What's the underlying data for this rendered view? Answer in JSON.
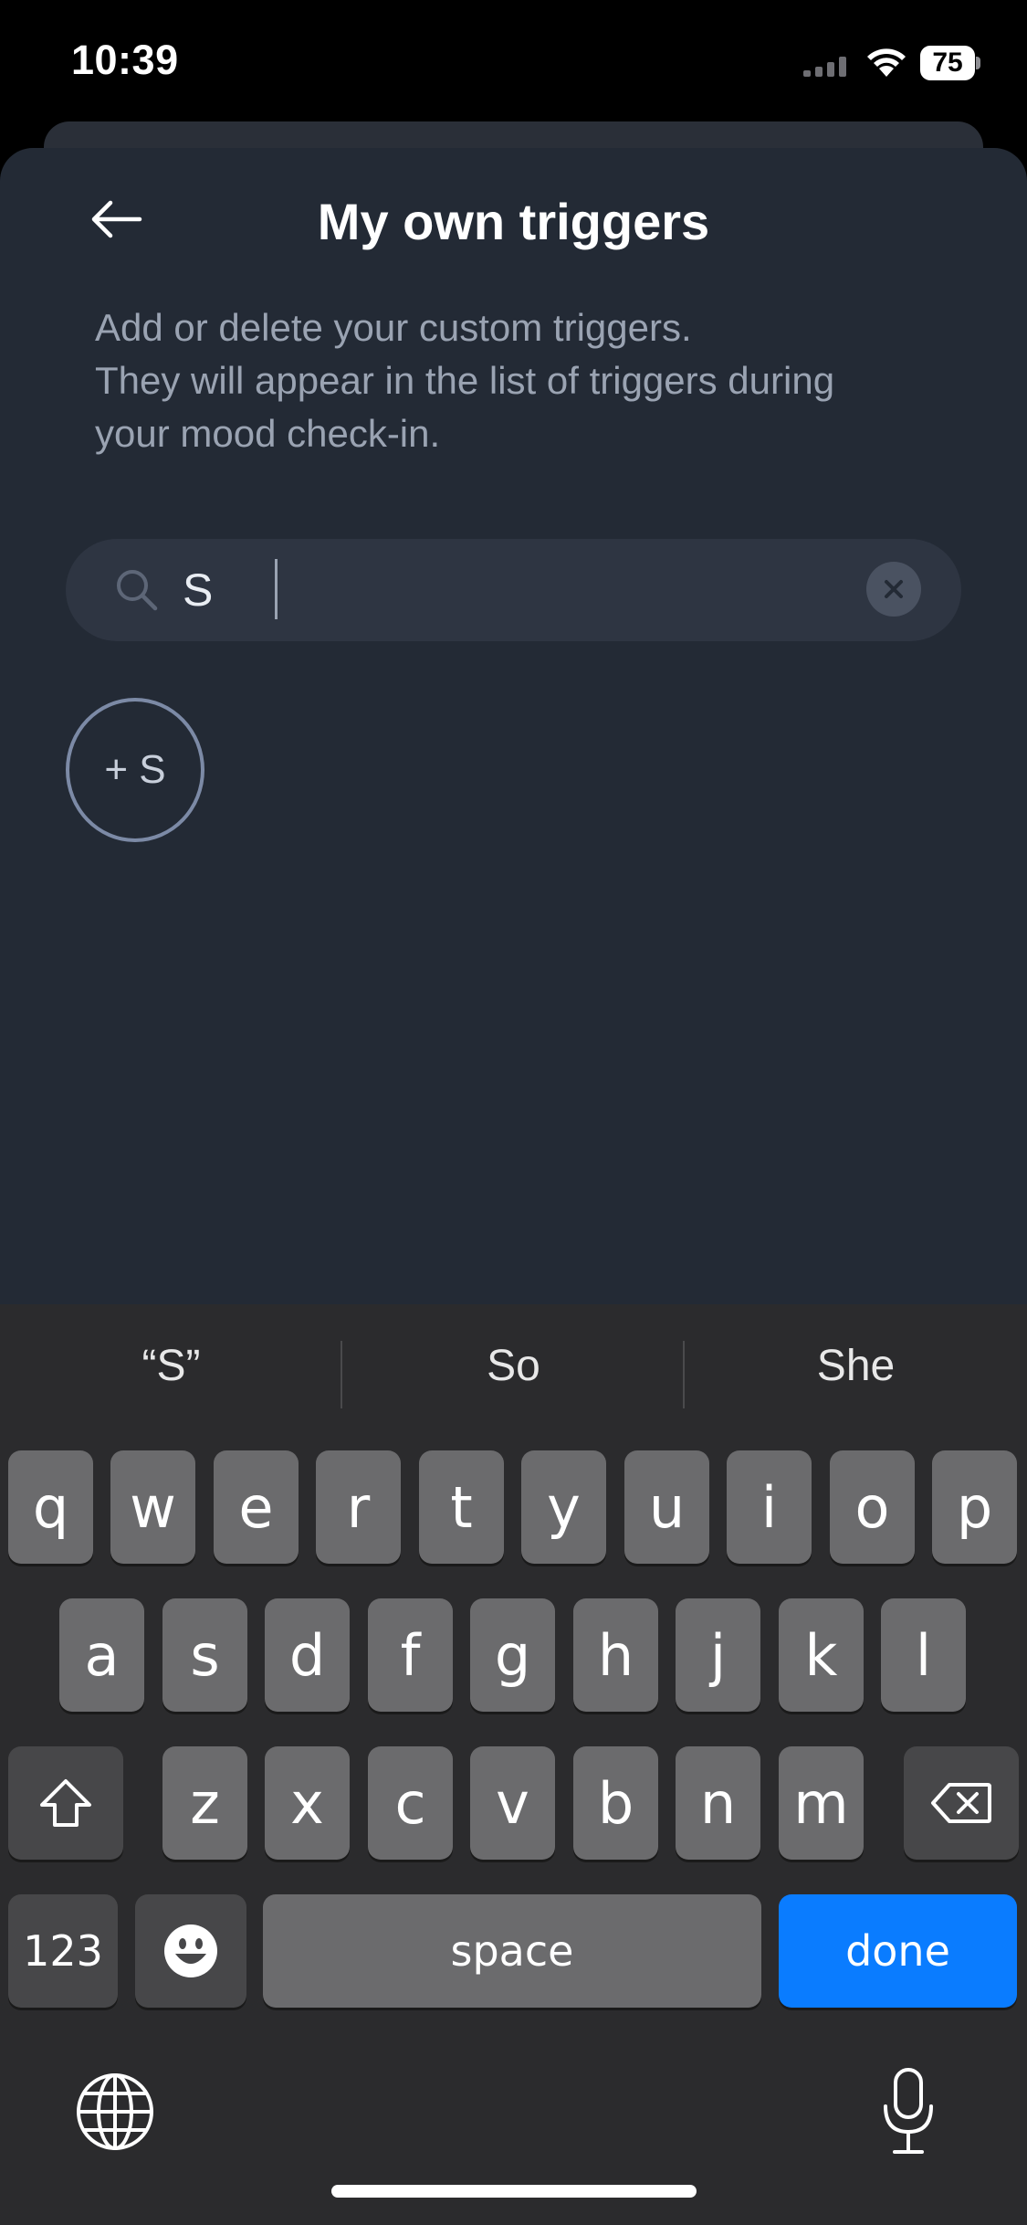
{
  "status_bar": {
    "time": "10:39",
    "battery": "75",
    "icons": [
      "signal-icon",
      "wifi-icon",
      "battery-icon"
    ]
  },
  "header": {
    "back_icon": "arrow-left-icon",
    "title": "My own triggers"
  },
  "description": {
    "lines": [
      "Add or delete your custom triggers.",
      "They will appear in the list of triggers during",
      "your mood check-in."
    ]
  },
  "search": {
    "value": "S",
    "icon": "search-icon",
    "clear_icon": "close-icon"
  },
  "add_chip": {
    "label": "+ S"
  },
  "keyboard": {
    "suggestions": [
      "“S”",
      "So",
      "She"
    ],
    "row1": [
      "q",
      "w",
      "e",
      "r",
      "t",
      "y",
      "u",
      "i",
      "o",
      "p"
    ],
    "row2": [
      "a",
      "s",
      "d",
      "f",
      "g",
      "h",
      "j",
      "k",
      "l"
    ],
    "row3": [
      "z",
      "x",
      "c",
      "v",
      "b",
      "n",
      "m"
    ],
    "numbers_label": "123",
    "space_label": "space",
    "done_label": "done",
    "icons": [
      "shift-icon",
      "delete-icon",
      "emoji-icon",
      "globe-icon",
      "microphone-icon"
    ]
  },
  "colors": {
    "sheet_bg": "#232a35",
    "search_bg": "#2e3542",
    "accent_done": "#0a7cff",
    "chip_border": "#7c8aa6"
  }
}
